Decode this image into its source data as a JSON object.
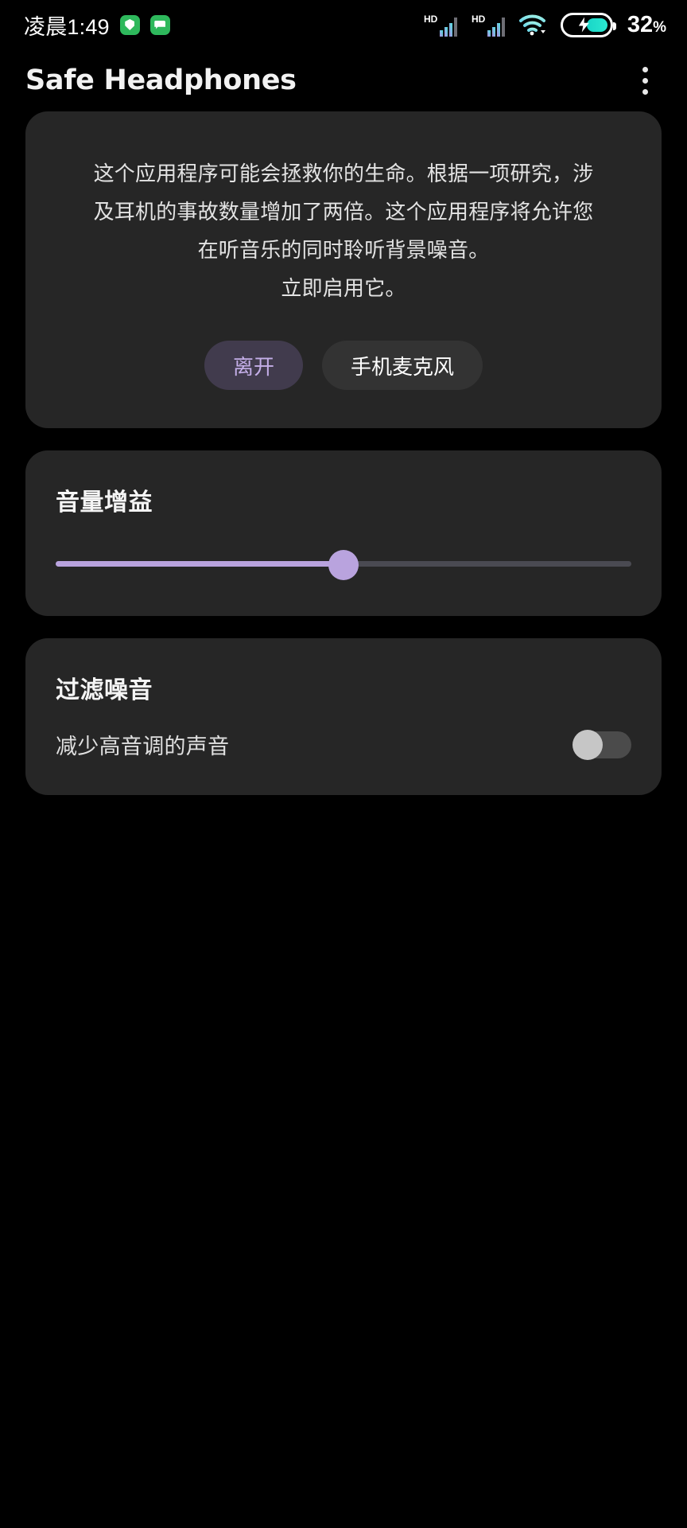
{
  "status_bar": {
    "clock": "凌晨1:49",
    "left_icons": [
      {
        "name": "security-app-icon",
        "glyph": "shield",
        "color": "#2eb85c"
      },
      {
        "name": "messages-app-icon",
        "glyph": "message",
        "color": "#2eb85c"
      }
    ],
    "signal_1_label": "HD",
    "signal_2_label": "HD",
    "wifi": "wifi-icon",
    "battery_percent": "32",
    "battery_percent_symbol": "%",
    "battery_charging": true
  },
  "app_bar": {
    "title": "Safe Headphones",
    "overflow_menu": "more-options"
  },
  "info_card": {
    "lines": [
      "这个应用程序可能会拯救你的生命。根据一项研究，涉",
      "及耳机的事故数量增加了两倍。这个应用程序将允许您",
      "在听音乐的同时聆听背景噪音。",
      "立即启用它。"
    ],
    "leave_button": "离开",
    "mic_button": "手机麦克风"
  },
  "volume_card": {
    "heading": "音量增益",
    "slider_value": 50,
    "slider_min": 0,
    "slider_max": 100,
    "active_color": "#b9a3de",
    "inactive_color": "#4a4a52"
  },
  "filter_card": {
    "heading": "过滤噪音",
    "subtitle": "减少高音调的声音",
    "switch_state": "off"
  },
  "theme": {
    "background": "#000000",
    "card": "#262626",
    "accent": "#b9a3de",
    "accent_soft": "#413b4d",
    "text_primary": "#f5f5f5",
    "text_secondary": "#e0e0e0"
  }
}
